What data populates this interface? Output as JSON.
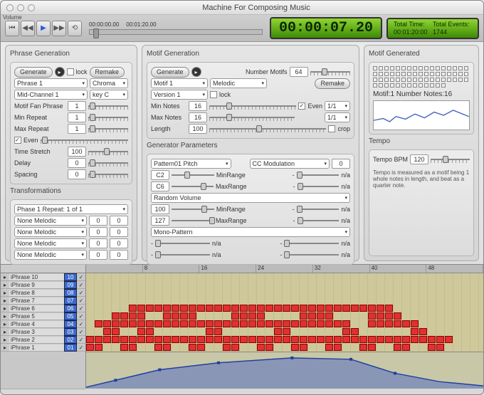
{
  "window_title": "Machine For Composing Music",
  "timecode_small_a": "00:00:00.00",
  "timecode_small_b": "00:01:20.00",
  "timecode_big": "00:00:07.20",
  "totals": {
    "time_lbl": "Total Time:",
    "time_val": "00:01:20:00",
    "events_lbl": "Total Events:",
    "events_val": "1744"
  },
  "phrase": {
    "title": "Phrase Generation",
    "generate": "Generate",
    "lock": "lock",
    "remake": "Remake",
    "phrase_sel": "Phrase 1",
    "chroma": "Chroma",
    "midi": "Mid-Channel 1",
    "key": "key C",
    "fan": "Motif Fan Phrase",
    "fan_v": "1",
    "minr": "Min Repeat",
    "minr_v": "1",
    "maxr": "Max Repeat",
    "maxr_v": "1",
    "even": "Even",
    "ts": "Time Stretch",
    "ts_v": "100",
    "delay": "Delay",
    "delay_v": "0",
    "spacing": "Spacing",
    "spacing_v": "0",
    "trans_title": "Transformations",
    "trans_top": "Phase 1 Repeat: 1 of 1",
    "none": "None Melodic",
    "zero": "0"
  },
  "motif": {
    "title": "Motif Generation",
    "generate": "Generate",
    "number_lbl": "Number Motifs",
    "number_v": "64",
    "motif_sel": "Motif 1",
    "melodic": "Melodic",
    "remake": "Remake",
    "version": "Version 1",
    "lock": "lock",
    "minn": "Min Notes",
    "minn_v": "16",
    "maxn": "Max Notes",
    "maxn_v": "16",
    "even": "Even",
    "len": "Length",
    "len_v": "100",
    "crop": "crop",
    "ratio_a": "1/1",
    "ratio_b": "1/1",
    "gen_title": "Generator Parameters",
    "pattern": "Pattern01 Pitch",
    "ccmod": "CC Modulation",
    "cc_v": "0",
    "c2": "C2",
    "minrange": "MinRange",
    "na": "n/a",
    "dash": "-",
    "c6": "C6",
    "maxrange": "MaxRange",
    "randvol": "Random Volume",
    "v100": "100",
    "v127": "127",
    "mono": "Mono-Pattern"
  },
  "generated": {
    "title": "Motif Generated",
    "stat": "Motif:1 Number Notes:16"
  },
  "tempo": {
    "title": "Tempo",
    "lbl": "Tempo BPM",
    "val": "120",
    "desc": "Tempo is measured as a motif being 1 whole notes in length, and beat as a quarter note."
  },
  "seq": {
    "ruler": [
      "",
      "8",
      "16",
      "24",
      "32",
      "40",
      "48"
    ],
    "tracks": [
      {
        "name": "iPhrase 10",
        "n": "10"
      },
      {
        "name": "iPhrase 9",
        "n": "09"
      },
      {
        "name": "iPhrase 8",
        "n": "08"
      },
      {
        "name": "iPhrase 7",
        "n": "07"
      },
      {
        "name": "iPhrase 6",
        "n": "06"
      },
      {
        "name": "iPhrase 5",
        "n": "05"
      },
      {
        "name": "iPhrase 4",
        "n": "04"
      },
      {
        "name": "iPhrase 3",
        "n": "03"
      },
      {
        "name": "iPhrase 2",
        "n": "02"
      },
      {
        "name": "iPhrase 1",
        "n": "01"
      }
    ],
    "vol": "Volume"
  }
}
